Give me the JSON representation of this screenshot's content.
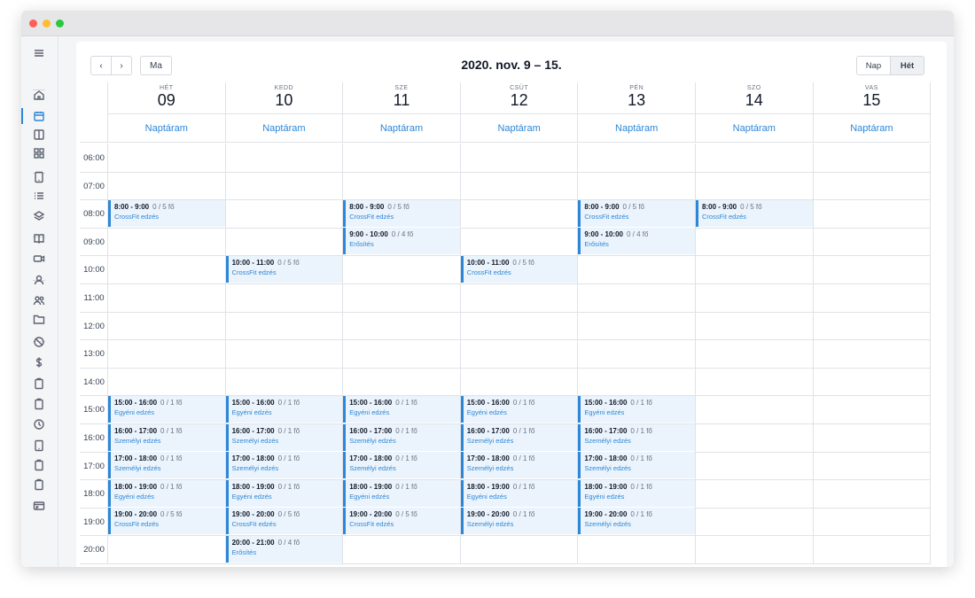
{
  "window": {
    "dot_colors": [
      "#ff5f57",
      "#febc2e",
      "#28c840"
    ]
  },
  "sidebar": {
    "icons": [
      "menu-icon",
      "home-icon",
      "calendar-icon",
      "columns-icon",
      "grid-icon",
      "tablet-icon",
      "list-icon",
      "layers-icon",
      "book-icon",
      "video-icon",
      "user-icon",
      "users-icon",
      "folder-icon",
      "ban-icon",
      "dollar-icon",
      "clipboard-icon",
      "clipboard-icon",
      "clock-icon",
      "tablet-icon",
      "clipboard-icon",
      "clipboard-icon",
      "id-card-icon"
    ],
    "active": "calendar-icon"
  },
  "toolbar": {
    "prev_label": "‹",
    "next_label": "›",
    "today_label": "Ma",
    "title": "2020. nov. 9 – 15.",
    "views": [
      {
        "label": "Nap",
        "active": false
      },
      {
        "label": "Hét",
        "active": true
      }
    ]
  },
  "days": [
    {
      "dow": "HÉT",
      "num": "09",
      "timetable": "Naptáram"
    },
    {
      "dow": "KEDD",
      "num": "10",
      "timetable": "Naptáram"
    },
    {
      "dow": "SZE",
      "num": "11",
      "timetable": "Naptáram"
    },
    {
      "dow": "CSÜT",
      "num": "12",
      "timetable": "Naptáram"
    },
    {
      "dow": "PÉN",
      "num": "13",
      "timetable": "Naptáram"
    },
    {
      "dow": "SZO",
      "num": "14",
      "timetable": "Naptáram"
    },
    {
      "dow": "VAS",
      "num": "15",
      "timetable": "Naptáram"
    }
  ],
  "hours": [
    "06:00",
    "07:00",
    "08:00",
    "09:00",
    "10:00",
    "11:00",
    "12:00",
    "13:00",
    "14:00",
    "15:00",
    "16:00",
    "17:00",
    "18:00",
    "19:00",
    "20:00"
  ],
  "events": [
    {
      "day": 0,
      "hour": 2,
      "time": "8:00 - 9:00",
      "cap": "0 / 5 fő",
      "name": "CrossFit edzés"
    },
    {
      "day": 2,
      "hour": 2,
      "time": "8:00 - 9:00",
      "cap": "0 / 5 fő",
      "name": "CrossFit edzés"
    },
    {
      "day": 4,
      "hour": 2,
      "time": "8:00 - 9:00",
      "cap": "0 / 5 fő",
      "name": "CrossFit edzés"
    },
    {
      "day": 5,
      "hour": 2,
      "time": "8:00 - 9:00",
      "cap": "0 / 5 fő",
      "name": "CrossFit edzés"
    },
    {
      "day": 2,
      "hour": 3,
      "time": "9:00 - 10:00",
      "cap": "0 / 4 fő",
      "name": "Erősítés"
    },
    {
      "day": 4,
      "hour": 3,
      "time": "9:00 - 10:00",
      "cap": "0 / 4 fő",
      "name": "Erősítés"
    },
    {
      "day": 1,
      "hour": 4,
      "time": "10:00 - 11:00",
      "cap": "0 / 5 fő",
      "name": "CrossFit edzés"
    },
    {
      "day": 3,
      "hour": 4,
      "time": "10:00 - 11:00",
      "cap": "0 / 5 fő",
      "name": "CrossFit edzés"
    },
    {
      "day": 0,
      "hour": 9,
      "time": "15:00 - 16:00",
      "cap": "0 / 1 fő",
      "name": "Egyéni edzés"
    },
    {
      "day": 1,
      "hour": 9,
      "time": "15:00 - 16:00",
      "cap": "0 / 1 fő",
      "name": "Egyéni edzés"
    },
    {
      "day": 2,
      "hour": 9,
      "time": "15:00 - 16:00",
      "cap": "0 / 1 fő",
      "name": "Egyéni edzés"
    },
    {
      "day": 3,
      "hour": 9,
      "time": "15:00 - 16:00",
      "cap": "0 / 1 fő",
      "name": "Egyéni edzés"
    },
    {
      "day": 4,
      "hour": 9,
      "time": "15:00 - 16:00",
      "cap": "0 / 1 fő",
      "name": "Egyéni edzés"
    },
    {
      "day": 0,
      "hour": 10,
      "time": "16:00 - 17:00",
      "cap": "0 / 1 fő",
      "name": "Személyi edzés"
    },
    {
      "day": 1,
      "hour": 10,
      "time": "16:00 - 17:00",
      "cap": "0 / 1 fő",
      "name": "Személyi edzés"
    },
    {
      "day": 2,
      "hour": 10,
      "time": "16:00 - 17:00",
      "cap": "0 / 1 fő",
      "name": "Személyi edzés"
    },
    {
      "day": 3,
      "hour": 10,
      "time": "16:00 - 17:00",
      "cap": "0 / 1 fő",
      "name": "Személyi edzés"
    },
    {
      "day": 4,
      "hour": 10,
      "time": "16:00 - 17:00",
      "cap": "0 / 1 fő",
      "name": "Személyi edzés"
    },
    {
      "day": 0,
      "hour": 11,
      "time": "17:00 - 18:00",
      "cap": "0 / 1 fő",
      "name": "Személyi edzés"
    },
    {
      "day": 1,
      "hour": 11,
      "time": "17:00 - 18:00",
      "cap": "0 / 1 fő",
      "name": "Személyi edzés"
    },
    {
      "day": 2,
      "hour": 11,
      "time": "17:00 - 18:00",
      "cap": "0 / 1 fő",
      "name": "Személyi edzés"
    },
    {
      "day": 3,
      "hour": 11,
      "time": "17:00 - 18:00",
      "cap": "0 / 1 fő",
      "name": "Személyi edzés"
    },
    {
      "day": 4,
      "hour": 11,
      "time": "17:00 - 18:00",
      "cap": "0 / 1 fő",
      "name": "Személyi edzés"
    },
    {
      "day": 0,
      "hour": 12,
      "time": "18:00 - 19:00",
      "cap": "0 / 1 fő",
      "name": "Egyéni edzés"
    },
    {
      "day": 1,
      "hour": 12,
      "time": "18:00 - 19:00",
      "cap": "0 / 1 fő",
      "name": "Egyéni edzés"
    },
    {
      "day": 2,
      "hour": 12,
      "time": "18:00 - 19:00",
      "cap": "0 / 1 fő",
      "name": "Egyéni edzés"
    },
    {
      "day": 3,
      "hour": 12,
      "time": "18:00 - 19:00",
      "cap": "0 / 1 fő",
      "name": "Egyéni edzés"
    },
    {
      "day": 4,
      "hour": 12,
      "time": "18:00 - 19:00",
      "cap": "0 / 1 fő",
      "name": "Egyéni edzés"
    },
    {
      "day": 0,
      "hour": 13,
      "time": "19:00 - 20:00",
      "cap": "0 / 5 fő",
      "name": "CrossFit edzés"
    },
    {
      "day": 1,
      "hour": 13,
      "time": "19:00 - 20:00",
      "cap": "0 / 5 fő",
      "name": "CrossFit edzés"
    },
    {
      "day": 2,
      "hour": 13,
      "time": "19:00 - 20:00",
      "cap": "0 / 5 fő",
      "name": "CrossFit edzés"
    },
    {
      "day": 3,
      "hour": 13,
      "time": "19:00 - 20:00",
      "cap": "0 / 1 fő",
      "name": "Személyi edzés"
    },
    {
      "day": 4,
      "hour": 13,
      "time": "19:00 - 20:00",
      "cap": "0 / 1 fő",
      "name": "Személyi edzés"
    },
    {
      "day": 1,
      "hour": 14,
      "time": "20:00 - 21:00",
      "cap": "0 / 4 fő",
      "name": "Erősítés"
    }
  ],
  "colors": {
    "accent": "#2d86d6",
    "event_bg": "#ebf4fc",
    "grid_line": "#dfe2e7"
  }
}
